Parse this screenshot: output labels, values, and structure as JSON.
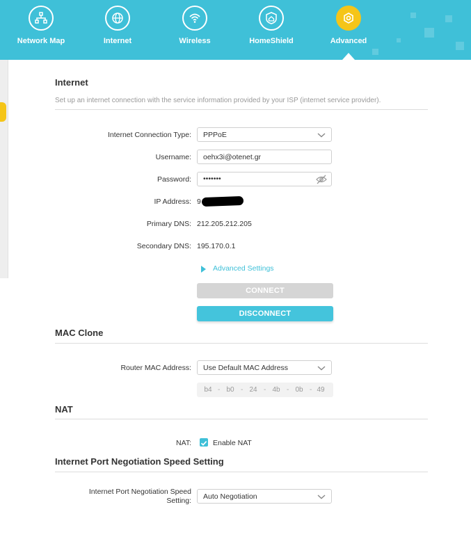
{
  "nav": {
    "items": [
      {
        "label": "Network Map",
        "icon": "network-map-icon"
      },
      {
        "label": "Internet",
        "icon": "globe-icon"
      },
      {
        "label": "Wireless",
        "icon": "wifi-icon"
      },
      {
        "label": "HomeShield",
        "icon": "home-shield-icon"
      },
      {
        "label": "Advanced",
        "icon": "gear-icon",
        "active": true
      }
    ]
  },
  "internet": {
    "title": "Internet",
    "description": "Set up an internet connection with the service information provided by your ISP (internet service provider).",
    "connection_type_label": "Internet Connection Type:",
    "connection_type_value": "PPPoE",
    "username_label": "Username:",
    "username_value": "oehx3i@otenet.gr",
    "password_label": "Password:",
    "password_value": "•••••••",
    "ip_label": "IP Address:",
    "ip_value": "9",
    "primary_dns_label": "Primary DNS:",
    "primary_dns_value": "212.205.212.205",
    "secondary_dns_label": "Secondary DNS:",
    "secondary_dns_value": "195.170.0.1",
    "advanced_settings_label": "Advanced Settings",
    "connect_label": "CONNECT",
    "disconnect_label": "DISCONNECT"
  },
  "mac_clone": {
    "title": "MAC Clone",
    "router_mac_label": "Router MAC Address:",
    "router_mac_value": "Use Default MAC Address",
    "mac_parts": [
      "b4",
      "b0",
      "24",
      "4b",
      "0b",
      "49"
    ],
    "separator": "-"
  },
  "nat": {
    "title": "NAT",
    "label": "NAT:",
    "enable_label": "Enable NAT",
    "enabled": true
  },
  "port_speed": {
    "title": "Internet Port Negotiation Speed Setting",
    "label_line1": "Internet Port Negotiation Speed",
    "label_line2": "Setting:",
    "value": "Auto Negotiation"
  },
  "colors": {
    "header": "#3fc0d8",
    "accent_yellow": "#f5c518",
    "button_disabled": "#d5d5d5",
    "button_primary": "#44c4dc"
  }
}
